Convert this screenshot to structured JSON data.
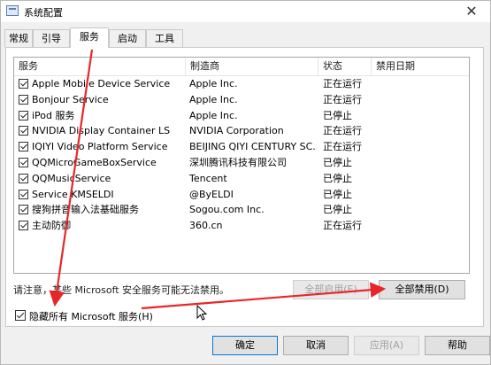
{
  "window": {
    "title": "系统配置",
    "close_glyph": "✕"
  },
  "tabs": [
    "常规",
    "引导",
    "服务",
    "启动",
    "工具"
  ],
  "active_tab": 2,
  "columns": [
    "服务",
    "制造商",
    "状态",
    "禁用日期"
  ],
  "services": [
    {
      "name": "Apple Mobile Device Service",
      "maker": "Apple Inc.",
      "status": "正在运行",
      "checked": true
    },
    {
      "name": "Bonjour Service",
      "maker": "Apple Inc.",
      "status": "正在运行",
      "checked": true
    },
    {
      "name": "iPod 服务",
      "maker": "Apple Inc.",
      "status": "已停止",
      "checked": true
    },
    {
      "name": "NVIDIA Display Container LS",
      "maker": "NVIDIA Corporation",
      "status": "正在运行",
      "checked": true
    },
    {
      "name": "IQIYI Video Platform Service",
      "maker": "BEIJING QIYI CENTURY SC...",
      "status": "正在运行",
      "checked": true
    },
    {
      "name": "QQMicroGameBoxService",
      "maker": "深圳腾讯科技有限公司",
      "status": "已停止",
      "checked": true
    },
    {
      "name": "QQMusicService",
      "maker": "Tencent",
      "status": "已停止",
      "checked": true
    },
    {
      "name": "Service KMSELDI",
      "maker": "@ByELDI",
      "status": "已停止",
      "checked": true
    },
    {
      "name": "搜狗拼音输入法基础服务",
      "maker": "Sogou.com Inc.",
      "status": "已停止",
      "checked": true
    },
    {
      "name": "主动防御",
      "maker": "360.cn",
      "status": "正在运行",
      "checked": true
    }
  ],
  "note": "请注意，某些 Microsoft 安全服务可能无法禁用。",
  "enable_all_label": "全部启用(E)",
  "disable_all_label": "全部禁用(D)",
  "hide_ms": {
    "label": "隐藏所有 Microsoft 服务(H)",
    "checked": true
  },
  "buttons": {
    "ok": "确定",
    "cancel": "取消",
    "apply": "应用(A)",
    "help": "帮助"
  },
  "colors": {
    "annotation_arrow": "#e8262a",
    "focus_border": "#0078d7"
  }
}
